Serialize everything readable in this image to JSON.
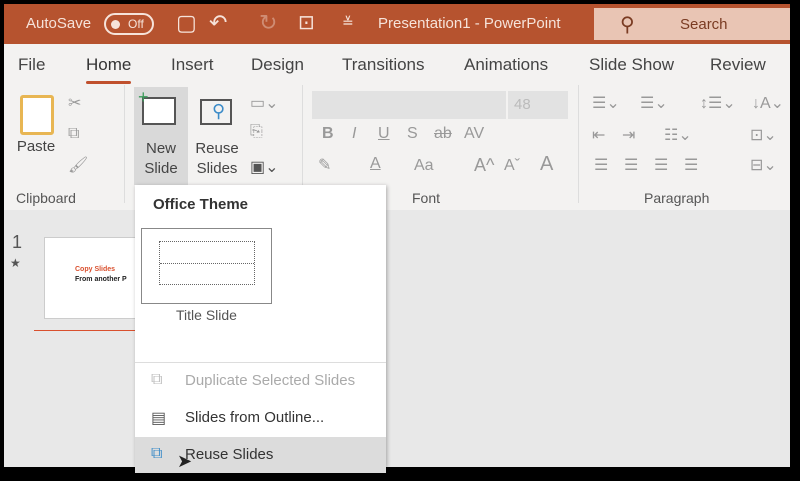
{
  "titlebar": {
    "autosave_label": "AutoSave",
    "autosave_state": "Off",
    "title": "Presentation1  -  PowerPoint",
    "search_placeholder": "Search"
  },
  "tabs": [
    "File",
    "Home",
    "Insert",
    "Design",
    "Transitions",
    "Animations",
    "Slide Show",
    "Review"
  ],
  "ribbon": {
    "clipboard": {
      "paste": "Paste",
      "group": "Clipboard"
    },
    "slides": {
      "new_slide_1": "New",
      "new_slide_2": "Slide",
      "reuse_1": "Reuse",
      "reuse_2": "Slides"
    },
    "font": {
      "font_name": "",
      "font_size": "48",
      "group": "Font",
      "bold": "B",
      "italic": "I",
      "underline": "U",
      "shadow": "S",
      "strike": "ab",
      "spacing": "AV",
      "case": "Aa",
      "grow": "A^",
      "shrink": "Aˇ",
      "color": "A"
    },
    "paragraph": {
      "group": "Paragraph"
    }
  },
  "slides_pane": {
    "slide_number": "1",
    "thumb_title": "Copy Slides",
    "thumb_sub": "From another P"
  },
  "menu": {
    "section": "Office Theme",
    "layout": "Title Slide",
    "items": [
      "Duplicate Selected Slides",
      "Slides from Outline...",
      "Reuse Slides"
    ]
  }
}
